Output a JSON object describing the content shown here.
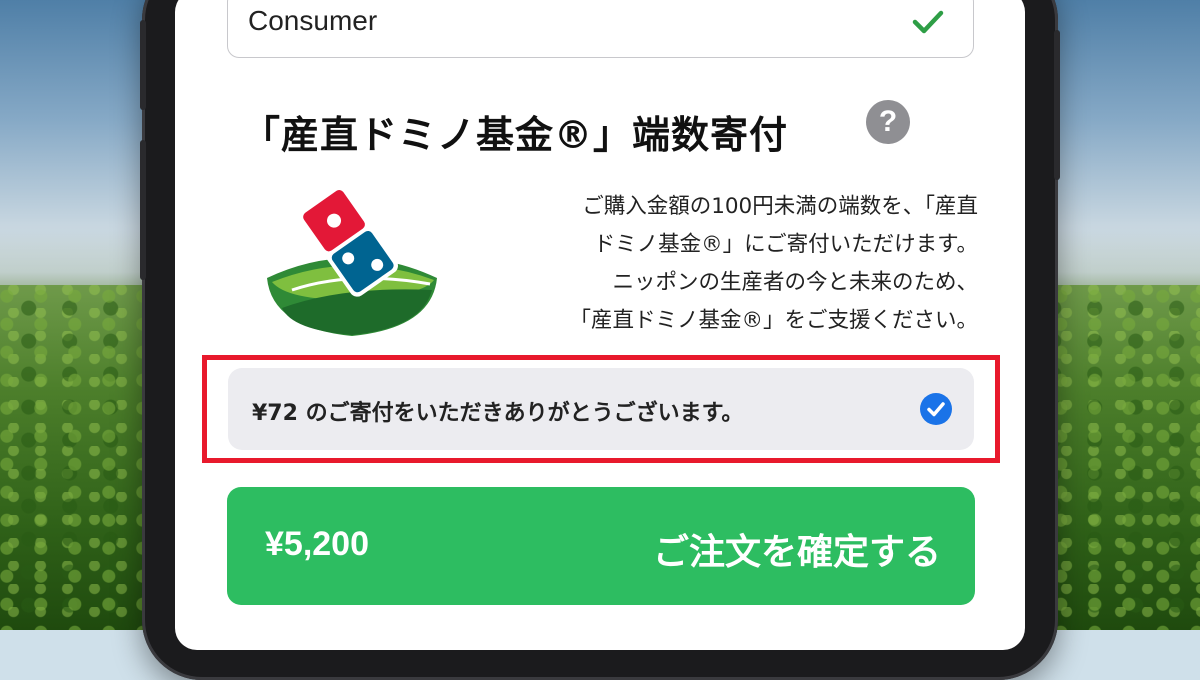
{
  "colors": {
    "accent_green": "#2dbd61",
    "check_green": "#2e9e46",
    "highlight_red": "#e8192c",
    "check_blue": "#1a73e8",
    "help_grey": "#8f8f93"
  },
  "form": {
    "field_value": "Consumer",
    "field_status_icon": "checkmark-icon"
  },
  "donation": {
    "heading": "「産直ドミノ基金®」端数寄付",
    "help_icon": "question-mark-icon",
    "help_glyph": "?",
    "logo_icon": "domino-fund-logo",
    "description_lines": [
      "ご購入金額の100円未満の端数を、「産直",
      "ドミノ基金®」にご寄付いただけます。",
      "ニッポンの生産者の今と未来のため、",
      "「産直ドミノ基金®」をご支援ください。"
    ],
    "confirmation_text": "¥72 のご寄付をいただきありがとうございます。",
    "confirmation_checked": true
  },
  "order": {
    "total": "¥5,200",
    "confirm_label": "ご注文を確定する"
  }
}
